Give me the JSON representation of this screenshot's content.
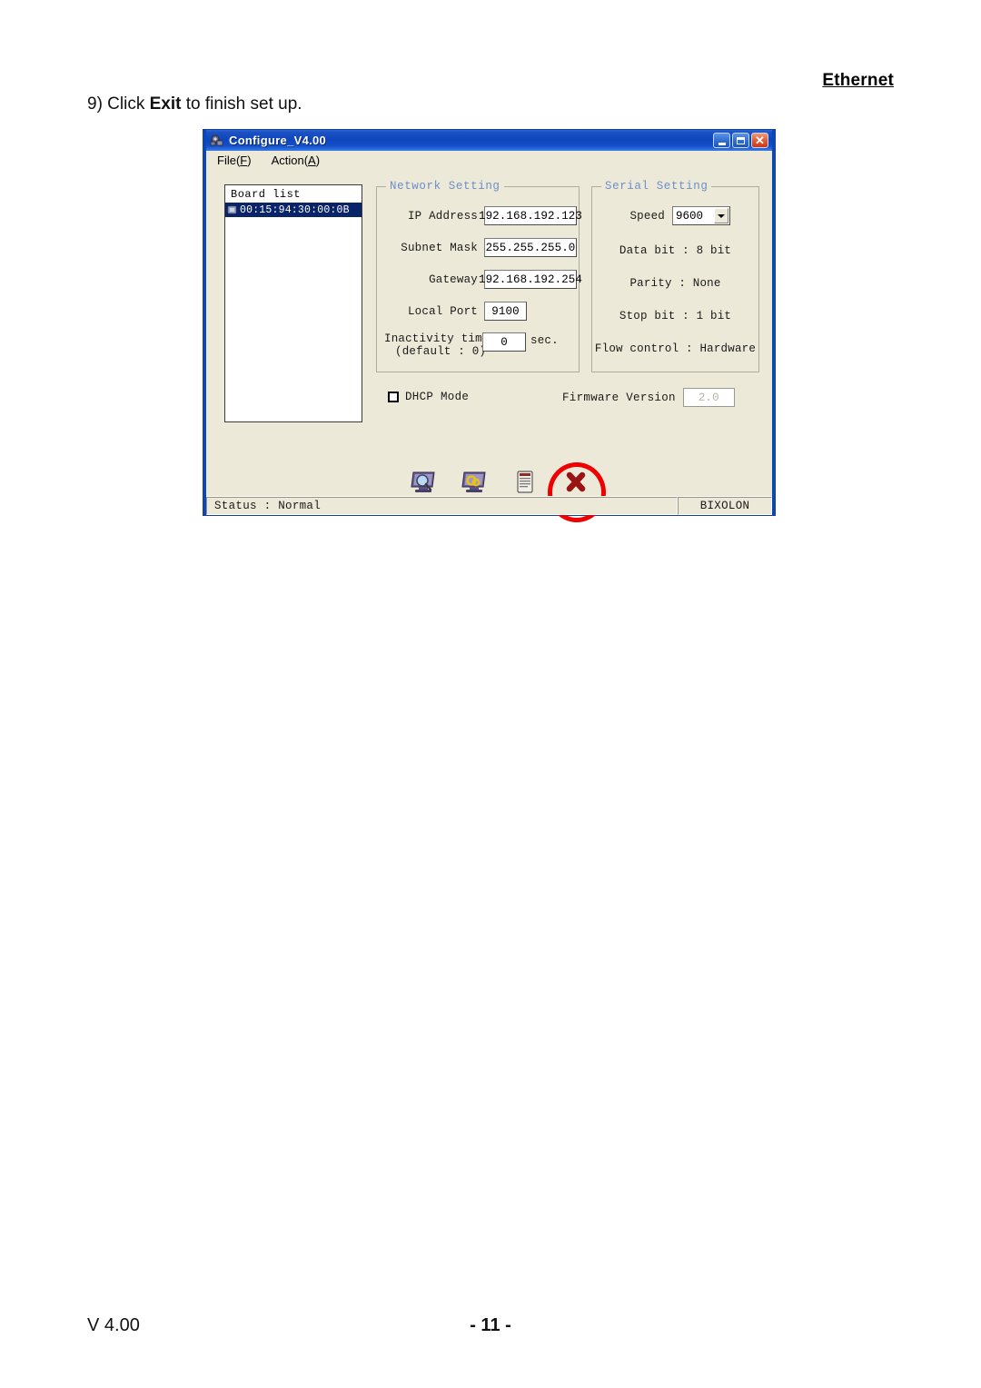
{
  "document": {
    "header_right": "Ethernet",
    "step_prefix": "9) Click ",
    "step_bold": "Exit",
    "step_suffix": " to finish set up.",
    "footer_version": "V 4.00",
    "footer_page": "- 11 -"
  },
  "window": {
    "title": "Configure_V4.00",
    "title_icon": "gear-network-icon",
    "caption": {
      "minimize": "minimize-icon",
      "maximize": "maximize-icon",
      "close": "✕"
    },
    "menu": [
      {
        "text": "File(F)",
        "label": "File(",
        "accel": "F",
        "tail": ")"
      },
      {
        "text": "Action(A)",
        "label": "Action(",
        "accel": "A",
        "tail": ")"
      }
    ]
  },
  "board_list": {
    "title": "Board list",
    "items": [
      {
        "icon": "chip-icon",
        "label": "00:15:94:30:00:0B",
        "selected": true
      }
    ]
  },
  "network_setting": {
    "title": "Network Setting",
    "fields": [
      {
        "label": "IP Address",
        "value": "192.168.192.123"
      },
      {
        "label": "Subnet Mask",
        "value": "255.255.255.0"
      },
      {
        "label": "Gateway",
        "value": "192.168.192.254"
      },
      {
        "label": "Local Port",
        "value": "9100"
      }
    ],
    "inactivity": {
      "label_line1": "Inactivity time",
      "label_line2": "(default : 0)",
      "value": "0",
      "unit": "sec."
    }
  },
  "serial_setting": {
    "title": "Serial Setting",
    "speed_label": "Speed",
    "speed_value": "9600",
    "lines": [
      "Data bit : 8 bit",
      "Parity : None",
      "Stop bit : 1 bit",
      "Flow control : Hardware"
    ]
  },
  "dhcp": {
    "label": "DHCP Mode",
    "checked": false
  },
  "firmware": {
    "label": "Firmware Version",
    "value": "2.0"
  },
  "toolbar": {
    "buttons": [
      {
        "icon": "search-monitor-icon",
        "label": "Search"
      },
      {
        "icon": "setting-monitor-icon",
        "label": "Setting"
      },
      {
        "icon": "upload-file-icon",
        "label": "Upload"
      },
      {
        "icon": "exit-x-icon",
        "label": "Exit"
      }
    ]
  },
  "statusbar": {
    "status": "Status : Normal",
    "brand": "BIXOLON"
  },
  "colors": {
    "titlebar_blue": "#0d45bd",
    "window_face": "#ece9d8",
    "selection_blue": "#0a246a",
    "group_title": "#6b8fc7",
    "annotation_red": "#ee0000"
  }
}
